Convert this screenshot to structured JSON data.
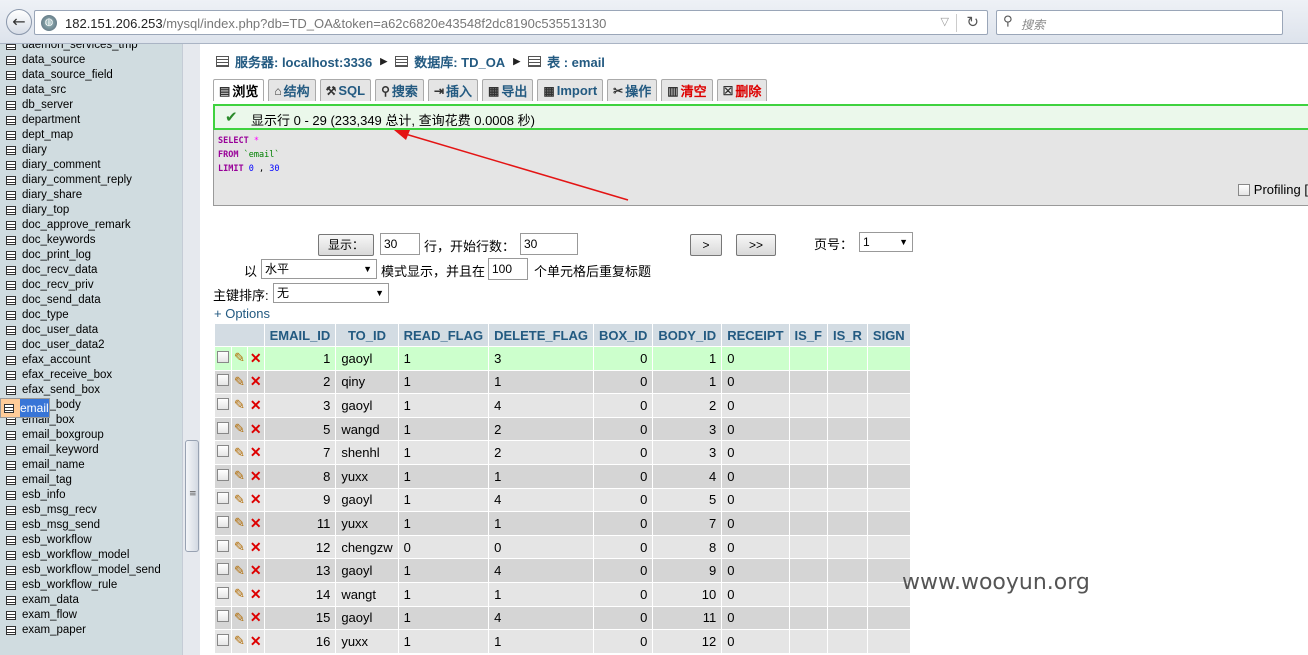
{
  "browser": {
    "url_host": "182.151.206.253",
    "url_path": "/mysql/index.php?db=TD_OA&token=a62c6820e43548f2dc8190c535513130",
    "search_placeholder": "搜索"
  },
  "sidebar": {
    "tables": [
      "daemon_services_tmp",
      "data_source",
      "data_source_field",
      "data_src",
      "db_server",
      "department",
      "dept_map",
      "diary",
      "diary_comment",
      "diary_comment_reply",
      "diary_share",
      "diary_top",
      "doc_approve_remark",
      "doc_keywords",
      "doc_print_log",
      "doc_recv_data",
      "doc_recv_priv",
      "doc_send_data",
      "doc_type",
      "doc_user_data",
      "doc_user_data2",
      "efax_account",
      "efax_receive_box",
      "efax_send_box",
      "email",
      "email_body",
      "email_box",
      "email_boxgroup",
      "email_keyword",
      "email_name",
      "email_tag",
      "esb_info",
      "esb_msg_recv",
      "esb_msg_send",
      "esb_workflow",
      "esb_workflow_model",
      "esb_workflow_model_send",
      "esb_workflow_rule",
      "exam_data",
      "exam_flow",
      "exam_paper"
    ],
    "selected": "email"
  },
  "breadcrumb": {
    "server": "服务器: localhost:3336",
    "database": "数据库: TD_OA",
    "table": "表 : email"
  },
  "tabs": [
    {
      "label": "浏览",
      "icon": "▤"
    },
    {
      "label": "结构",
      "icon": "⌂"
    },
    {
      "label": "SQL",
      "icon": "⚒"
    },
    {
      "label": "搜索",
      "icon": "⚲"
    },
    {
      "label": "插入",
      "icon": "⇥"
    },
    {
      "label": "导出",
      "icon": "▦"
    },
    {
      "label": "Import",
      "icon": "▦"
    },
    {
      "label": "操作",
      "icon": "✂"
    },
    {
      "label": "清空",
      "icon": "▥"
    },
    {
      "label": "删除",
      "icon": "☒"
    }
  ],
  "result": {
    "message": "显示行 0 - 29 (233,349 总计, 查询花费 0.0008 秒)",
    "sql": {
      "select_kw": "SELECT",
      "select_arg": "*",
      "from_kw": "FROM",
      "from_arg": "`email`",
      "limit_kw": "LIMIT",
      "limit_start": "0",
      "limit_sep": ",",
      "limit_count": "30"
    },
    "profiling_label": "Profiling ["
  },
  "navigation": {
    "show_button": "显示：",
    "rows_value": "30",
    "rows_label": "行，开始行数：",
    "start_value": "30",
    "next_button": ">",
    "last_button": ">>",
    "page_label": "页号：",
    "page_value": "1",
    "mode_prefix": "以",
    "mode_value": "水平",
    "mode_label": "模式显示，并且在",
    "repeat_value": "100",
    "repeat_label": "个单元格后重复标题",
    "sort_label": "主键排序:",
    "sort_value": "无",
    "options_link": "+ Options"
  },
  "table": {
    "columns": [
      "EMAIL_ID",
      "TO_ID",
      "READ_FLAG",
      "DELETE_FLAG",
      "BOX_ID",
      "BODY_ID",
      "RECEIPT",
      "IS_F",
      "IS_R",
      "SIGN"
    ],
    "rows": [
      [
        "1",
        "gaoyl",
        "1",
        "3",
        "0",
        "1",
        "0",
        "",
        "",
        ""
      ],
      [
        "2",
        "qiny",
        "1",
        "1",
        "0",
        "1",
        "0",
        "",
        "",
        ""
      ],
      [
        "3",
        "gaoyl",
        "1",
        "4",
        "0",
        "2",
        "0",
        "",
        "",
        ""
      ],
      [
        "5",
        "wangd",
        "1",
        "2",
        "0",
        "3",
        "0",
        "",
        "",
        ""
      ],
      [
        "7",
        "shenhl",
        "1",
        "2",
        "0",
        "3",
        "0",
        "",
        "",
        ""
      ],
      [
        "8",
        "yuxx",
        "1",
        "1",
        "0",
        "4",
        "0",
        "",
        "",
        ""
      ],
      [
        "9",
        "gaoyl",
        "1",
        "4",
        "0",
        "5",
        "0",
        "",
        "",
        ""
      ],
      [
        "11",
        "yuxx",
        "1",
        "1",
        "0",
        "7",
        "0",
        "",
        "",
        ""
      ],
      [
        "12",
        "chengzw",
        "0",
        "0",
        "0",
        "8",
        "0",
        "",
        "",
        ""
      ],
      [
        "13",
        "gaoyl",
        "1",
        "4",
        "0",
        "9",
        "0",
        "",
        "",
        ""
      ],
      [
        "14",
        "wangt",
        "1",
        "1",
        "0",
        "10",
        "0",
        "",
        "",
        ""
      ],
      [
        "15",
        "gaoyl",
        "1",
        "4",
        "0",
        "11",
        "0",
        "",
        "",
        ""
      ],
      [
        "16",
        "yuxx",
        "1",
        "1",
        "0",
        "12",
        "0",
        "",
        "",
        ""
      ]
    ]
  },
  "watermark": "www.wooyun.org"
}
